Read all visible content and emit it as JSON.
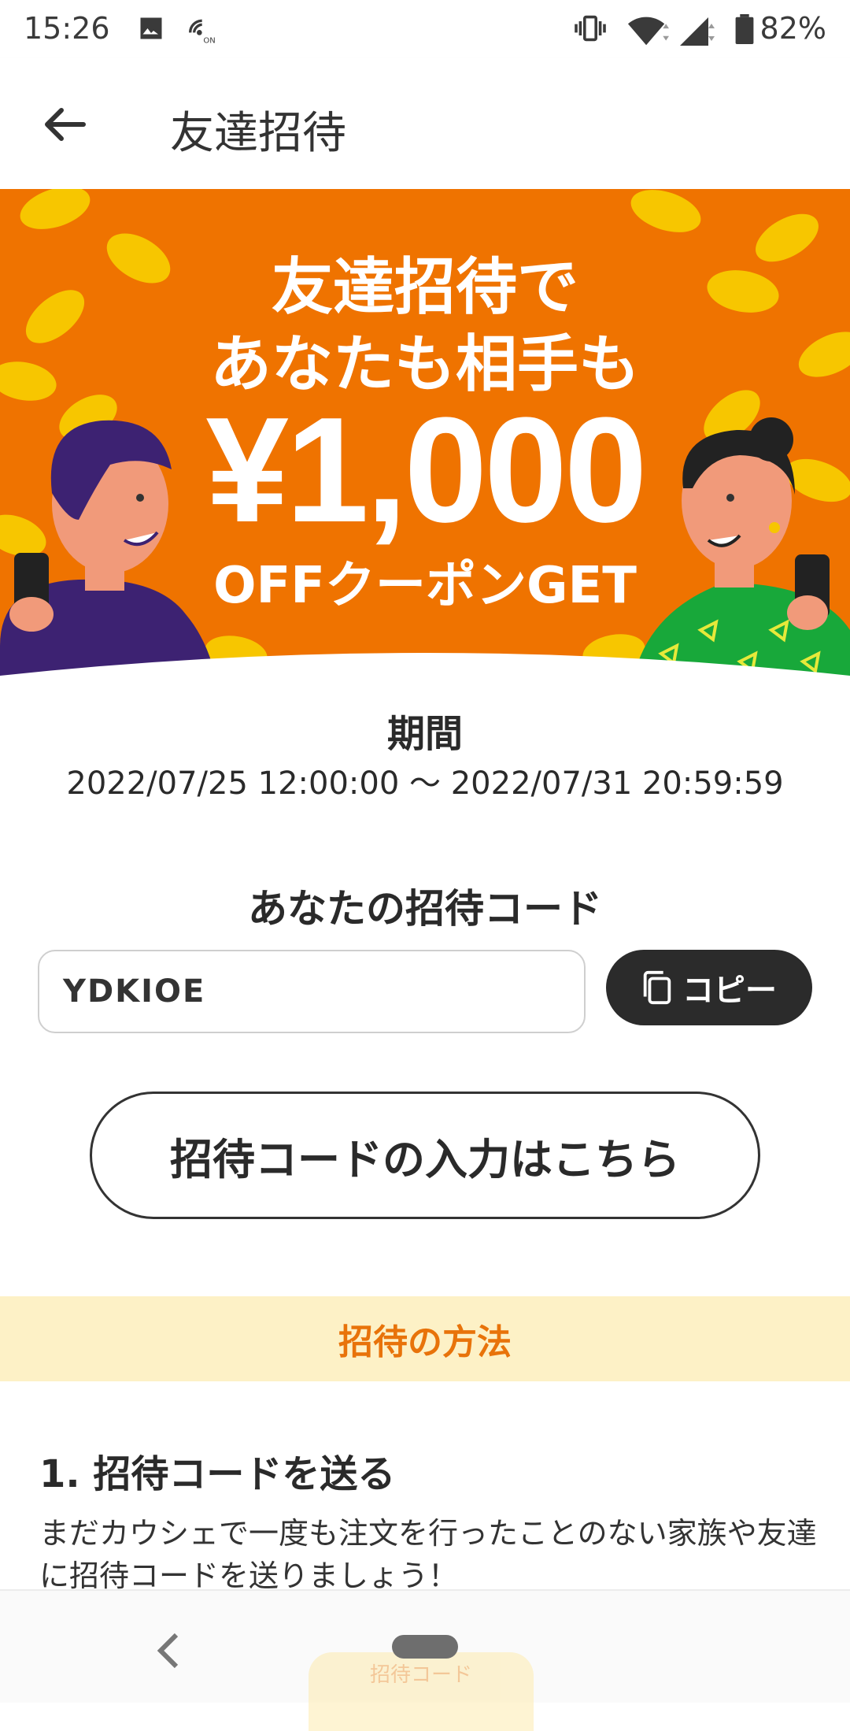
{
  "status_bar": {
    "time": "15:26",
    "battery": "82%",
    "icons": [
      "image-icon",
      "nfc-icon",
      "vibrate-icon",
      "wifi-icon",
      "signal-icon",
      "battery-icon"
    ]
  },
  "app_bar": {
    "title": "友達招待",
    "back_icon": "arrow-back-icon"
  },
  "banner": {
    "line1": "友達招待で",
    "line2": "あなたも相手も",
    "amount": "¥1,000",
    "subtitle": "OFFクーポンGET",
    "colors": {
      "background": "#ef7300",
      "coin": "#f7c600",
      "accent_green": "#18a83a",
      "accent_purple": "#3d2272"
    }
  },
  "period": {
    "label": "期間",
    "value": "2022/07/25 12:00:00 〜 2022/07/31 20:59:59"
  },
  "invite_code": {
    "heading": "あなたの招待コード",
    "value": "YDKIOE",
    "copy_label": "コピー",
    "copy_icon": "copy-icon"
  },
  "enter_code_button": {
    "label": "招待コードの入力はこちら"
  },
  "how_to": {
    "header": "招待の方法",
    "steps": [
      {
        "title": "1. 招待コードを送る",
        "description": "まだカウシェで一度も注文を行ったことのない家族や友達に招待コードを送りましょう！"
      }
    ]
  },
  "peek_card": {
    "label": "招待コード"
  },
  "nav_bar": {
    "back_icon": "nav-back-icon",
    "home_icon": "home-pill-icon"
  }
}
